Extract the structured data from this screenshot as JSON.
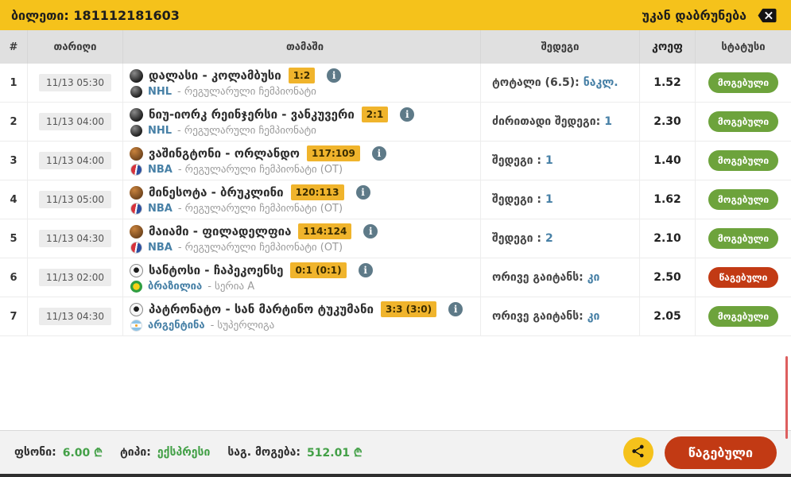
{
  "colors": {
    "accent-yellow": "#f5c21b",
    "score-yellow": "#f0b42c",
    "green": "#6da33c",
    "red": "#c23a14",
    "link-blue": "#4780a6",
    "info-gray": "#5e7a88",
    "value-green": "#43a047"
  },
  "header": {
    "ticket_label": "ბილეთი:",
    "ticket_number": "181112181603",
    "back_label": "უკან დაბრუნება"
  },
  "icons": {
    "info_glyph": "i"
  },
  "table": {
    "columns": {
      "num": "#",
      "date": "თარიღი",
      "game": "თამაში",
      "result": "შედეგი",
      "odds": "კოეფ",
      "status": "სტატუსი"
    },
    "rows": [
      {
        "num": "1",
        "date": "11/13 05:30",
        "sport": "hockey",
        "league_icon": "nhl",
        "teams": "დალასი - კოლამბუსი",
        "score": "1:2",
        "league": "NHL",
        "league_rest": "- რეგულარული ჩემპიონატი",
        "bet": "ტოტალი (6.5):",
        "pick": "ნაკლ.",
        "odds": "1.52",
        "status": "მოგებული",
        "status_type": "won"
      },
      {
        "num": "2",
        "date": "11/13 04:00",
        "sport": "hockey",
        "league_icon": "nhl",
        "teams": "ნიუ-იორკ რეინჯერსი - ვანკუვერი",
        "score": "2:1",
        "league": "NHL",
        "league_rest": "- რეგულარული ჩემპიონატი",
        "bet": "ძირითადი შედეგი:",
        "pick": "1",
        "odds": "2.30",
        "status": "მოგებული",
        "status_type": "won"
      },
      {
        "num": "3",
        "date": "11/13 04:00",
        "sport": "basketball",
        "league_icon": "nba",
        "teams": "ვაშინგტონი - ორლანდო",
        "score": "117:109",
        "league": "NBA",
        "league_rest": "- რეგულარული ჩემპიონატი (OT)",
        "bet": "შედეგი :",
        "pick": "1",
        "odds": "1.40",
        "status": "მოგებული",
        "status_type": "won"
      },
      {
        "num": "4",
        "date": "11/13 05:00",
        "sport": "basketball",
        "league_icon": "nba",
        "teams": "მინესოტა - ბრუკლინი",
        "score": "120:113",
        "league": "NBA",
        "league_rest": "- რეგულარული ჩემპიონატი (OT)",
        "bet": "შედეგი :",
        "pick": "1",
        "odds": "1.62",
        "status": "მოგებული",
        "status_type": "won"
      },
      {
        "num": "5",
        "date": "11/13 04:30",
        "sport": "basketball",
        "league_icon": "nba",
        "teams": "მაიამი - ფილადელფია",
        "score": "114:124",
        "league": "NBA",
        "league_rest": "- რეგულარული ჩემპიონატი (OT)",
        "bet": "შედეგი :",
        "pick": "2",
        "odds": "2.10",
        "status": "მოგებული",
        "status_type": "won"
      },
      {
        "num": "6",
        "date": "11/13 02:00",
        "sport": "soccer",
        "league_icon": "brazil",
        "teams": "სანტოსი - ჩაპეკოენსე",
        "score": "0:1 (0:1)",
        "league": "ბრაზილია",
        "league_rest": "- სერია A",
        "bet": "ორივე გაიტანს:",
        "pick": "კი",
        "odds": "2.50",
        "status": "წაგებული",
        "status_type": "lost"
      },
      {
        "num": "7",
        "date": "11/13 04:30",
        "sport": "soccer",
        "league_icon": "argentina",
        "teams": "პატრონატო - სან მარტინო ტუკუმანი",
        "score": "3:3 (3:0)",
        "league": "არგენტინა",
        "league_rest": "- სუპერლიგა",
        "bet": "ორივე გაიტანს:",
        "pick": "კი",
        "odds": "2.05",
        "status": "მოგებული",
        "status_type": "won"
      }
    ]
  },
  "footer": {
    "stake_label": "ფსონი:",
    "stake_value": "6.00 ₾",
    "type_label": "ტიპი:",
    "type_value": "ექსპრესი",
    "payout_label": "საგ. მოგება:",
    "payout_value": "512.01 ₾",
    "result_button": "წაგებული"
  }
}
